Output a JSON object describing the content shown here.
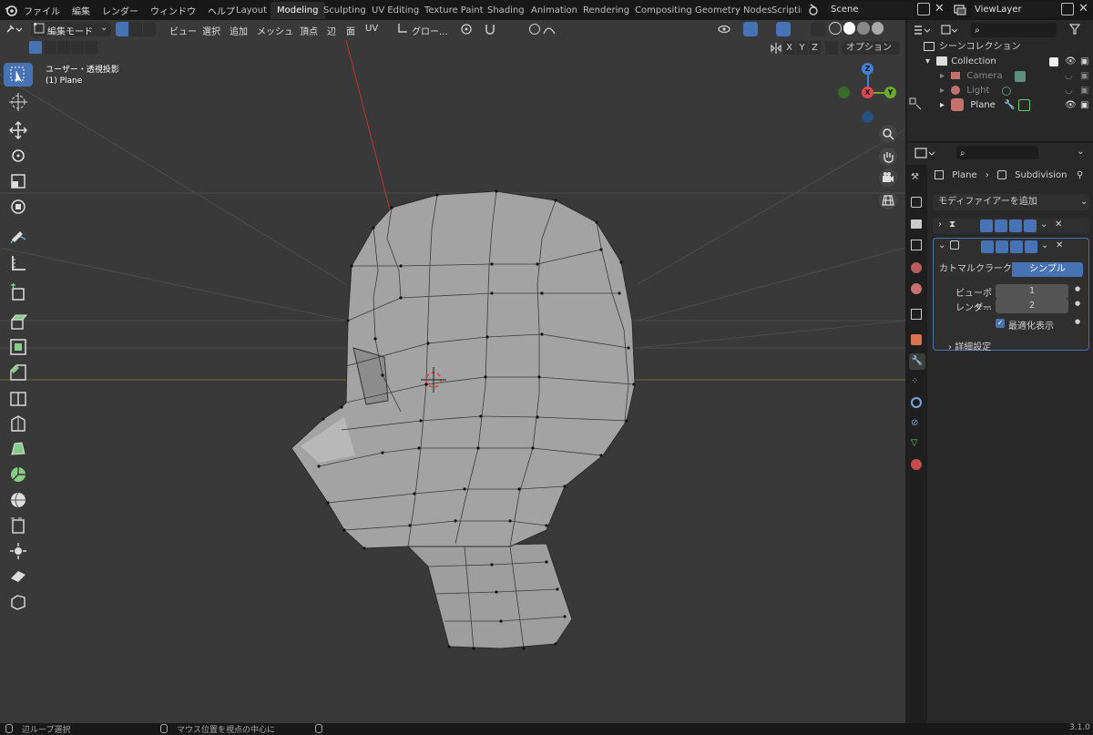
{
  "topbar": {
    "menus": [
      "ファイル",
      "編集",
      "レンダー",
      "ウィンドウ",
      "ヘルプ"
    ],
    "workspaces": [
      "Layout",
      "Modeling",
      "Sculpting",
      "UV Editing",
      "Texture Paint",
      "Shading",
      "Animation",
      "Rendering",
      "Compositing",
      "Geometry Nodes",
      "Scriptir"
    ],
    "active_workspace": "Modeling",
    "scene": "Scene",
    "viewlayer": "ViewLayer"
  },
  "viewport_header": {
    "mode": "編集モード",
    "menus": [
      "ビュー",
      "選択",
      "追加",
      "メッシュ",
      "頂点",
      "辺",
      "面",
      "UV"
    ],
    "transform_orient": "グロー...",
    "options": "オプション",
    "axes": [
      "X",
      "Y",
      "Z"
    ]
  },
  "viewport": {
    "view_label": "ユーザー・透視投影",
    "object_label": "(1) Plane",
    "gizmo": {
      "x": "X",
      "y": "Y",
      "z": "Z"
    }
  },
  "outliner": {
    "title": "シーンコレクション",
    "collection": "Collection",
    "items": [
      {
        "name": "Camera"
      },
      {
        "name": "Light"
      },
      {
        "name": "Plane"
      }
    ]
  },
  "properties": {
    "object": "Plane",
    "modifier": "Subdivision",
    "add_modifier": "モディファイアーを追加",
    "mod": {
      "tabs": [
        "カトマルクラーク",
        "シンプル"
      ],
      "active_tab": "シンプル",
      "viewport_label": "ビューポー...",
      "viewport_value": "1",
      "render_label": "レンダー",
      "render_value": "2",
      "optimal": "最適化表示",
      "advanced": "詳細設定"
    }
  },
  "status": {
    "left": "辺ループ選択",
    "middle": "マウス位置を視点の中心に",
    "version": "3.1.0"
  },
  "colors": {
    "accent": "#4772b3",
    "x_axis": "#e0474e",
    "y_axis": "#6aaa2d",
    "z_axis": "#3d82d6",
    "mesh": "#a3a3a3"
  }
}
